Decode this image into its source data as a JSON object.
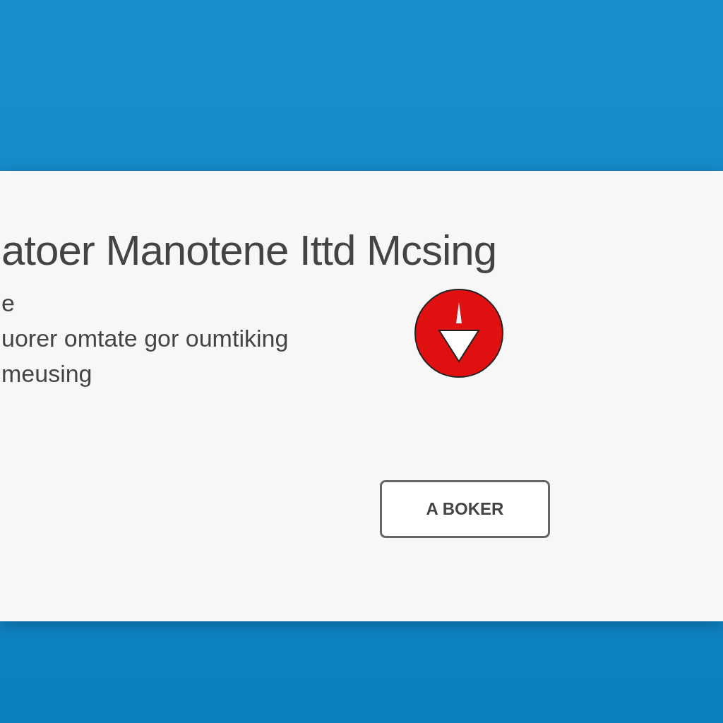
{
  "dialog": {
    "title": "atoer Manotene Ittd Mcsing",
    "message_lines": [
      "e",
      "uorer omtate gor oumtiking",
      "meusing"
    ],
    "icon": {
      "kind": "warning"
    },
    "buttons": [
      "A BOKER"
    ]
  }
}
